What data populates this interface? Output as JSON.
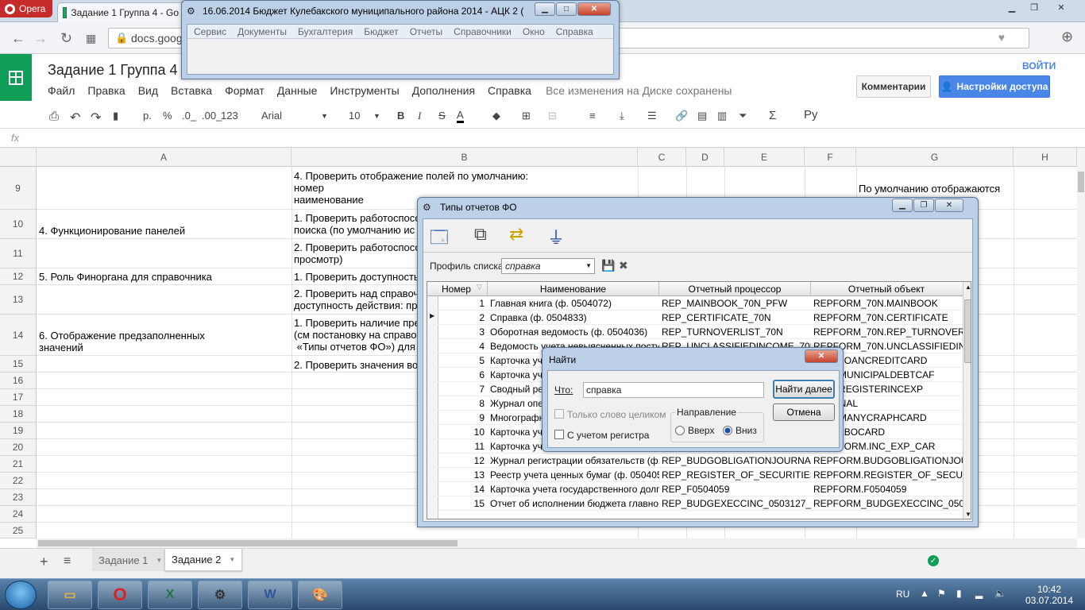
{
  "browser": {
    "app_name": "Opera",
    "tab_title": "Задание 1 Группа 4 - Go",
    "url": "docs.goog"
  },
  "sheets": {
    "title": "Задание 1 Группа 4",
    "menu": [
      "Файл",
      "Правка",
      "Вид",
      "Вставка",
      "Формат",
      "Данные",
      "Инструменты",
      "Дополнения",
      "Справка"
    ],
    "save_status": "Все изменения на Диске сохранены",
    "login": "ВОЙТИ",
    "comments": "Комментарии",
    "share": "Настройки доступа",
    "toolbar": {
      "format_p": "р.",
      "percent": "%",
      "dec_less": ".0_",
      "dec_more": ".00_",
      "num_format": "123",
      "font": "Arial",
      "size": "10",
      "bold": "B",
      "italic": "I",
      "strike": "S",
      "textcolor": "A",
      "sigma": "Σ",
      "lang": "Ру"
    },
    "fx": "fx",
    "columns": [
      "A",
      "B",
      "C",
      "D",
      "E",
      "F",
      "G",
      "H"
    ],
    "rows": [
      "9",
      "10",
      "11",
      "12",
      "13",
      "14",
      "15",
      "16",
      "17",
      "18",
      "19",
      "20",
      "21",
      "22",
      "23",
      "24",
      "25"
    ],
    "cells": {
      "b9": "4. Проверить отображение полей по умолчанию:\nномер\nнаименование",
      "g9": "По умолчанию отображаются",
      "a10": "4. Функционирование панелей",
      "b10": "1. Проверить работоспосо\nпоиска (по умолчанию ис",
      "b11": "2. Проверить работоспосо\nпросмотр)",
      "a12": "5. Роль Финоргана для справочника",
      "b12": "1. Проверить доступность",
      "b13": "2. Проверить над справоч\nдоступность действия: пр",
      "a14": "6. Отображение предзаполненных\nзначений",
      "b14": "1. Проверить наличие пре\n(см постановку на справо\n «Типы отчетов ФО») для",
      "b15": "2. Проверить значения во"
    },
    "sheet_tabs": [
      "Задание 1",
      "Задание 2"
    ]
  },
  "ack_main": {
    "title": "16.06.2014 Бюджет Кулебакского муниципального района 2014 - АЦК 2 (",
    "menu": [
      "Сервис",
      "Документы",
      "Бухгалтерия",
      "Бюджет",
      "Отчеты",
      "Справочники",
      "Окно",
      "Справка"
    ]
  },
  "report_types": {
    "title": "Типы отчетов ФО",
    "profile_label": "Профиль списка",
    "profile_value": "справка",
    "headers": [
      "Номер",
      "Наименование",
      "Отчетный процессор",
      "Отчетный объект"
    ],
    "rows": [
      {
        "num": "1",
        "name": "Главная книга (ф. 0504072)",
        "proc": "REP_MAINBOOK_70N_PFW",
        "obj": "REPFORM_70N.MAINBOOK"
      },
      {
        "num": "2",
        "name": "Справка (ф. 0504833)",
        "proc": "REP_CERTIFICATE_70N",
        "obj": "REPFORM_70N.CERTIFICATE"
      },
      {
        "num": "3",
        "name": "Оборотная ведомость (ф. 0504036)",
        "proc": "REP_TURNOVERLIST_70N",
        "obj": "REPFORM_70N.REP_TURNOVERLIST_70"
      },
      {
        "num": "4",
        "name": "Ведомость учета невыясненных поступле",
        "proc": "REP_UNCLASSIFIEDINCOME_70N",
        "obj": "REPFORM_70N.UNCLASSIFIEDINCOI"
      },
      {
        "num": "5",
        "name": "Карточка учет",
        "proc": "",
        "obj": "_70N.LOANCREDITCARD"
      },
      {
        "num": "6",
        "name": "Карточка учет",
        "proc": "",
        "obj": "_70N.MUNICIPALDEBTCAF"
      },
      {
        "num": "7",
        "name": "Сводный реес",
        "proc": "",
        "obj": "_70N.REGISTERINCEXP"
      },
      {
        "num": "8",
        "name": "Журнал опера",
        "proc": "",
        "obj": "JOURNAL"
      },
      {
        "num": "9",
        "name": "Многографна",
        "proc": "",
        "obj": "_70N.MANYCRAPHCARD"
      },
      {
        "num": "10",
        "name": "Карточка учет",
        "proc": "",
        "obj": "_70N.LBOCARD"
      },
      {
        "num": "11",
        "name": "Карточка учет",
        "proc": "",
        "obj": "_REPFORM.INC_EXP_CAR"
      },
      {
        "num": "12",
        "name": "Журнал регистрации обязательств (ф. 05",
        "proc": "REP_BUDGOBLIGATIONJOURNAL",
        "obj": "REPFORM.BUDGOBLIGATIONJOURN"
      },
      {
        "num": "13",
        "name": "Реестр учета ценных бумаг (ф. 0504056)",
        "proc": "REP_REGISTER_OF_SECURITIES",
        "obj": "REPFORM.REGISTER_OF_SECURITI"
      },
      {
        "num": "14",
        "name": "Карточка учета государственного долга Р",
        "proc": "REP_F0504059",
        "obj": "REPFORM.F0504059"
      },
      {
        "num": "15",
        "name": "Отчет об исполнении бюджета главного р",
        "proc": "REP_BUDGEXECCINC_0503127_72N",
        "obj": "REPFORM_BUDGEXECCINC_050312"
      }
    ]
  },
  "find_dialog": {
    "title": "Найти",
    "what_label": "Что:",
    "what_value": "справка",
    "find_next": "Найти далее",
    "cancel": "Отмена",
    "whole_word": "Только слово целиком",
    "match_case": "С учетом регистра",
    "direction_label": "Направление",
    "up": "Вверх",
    "down": "Вниз"
  },
  "taskbar": {
    "lang": "RU",
    "time": "10:42",
    "date": "03.07.2014"
  }
}
